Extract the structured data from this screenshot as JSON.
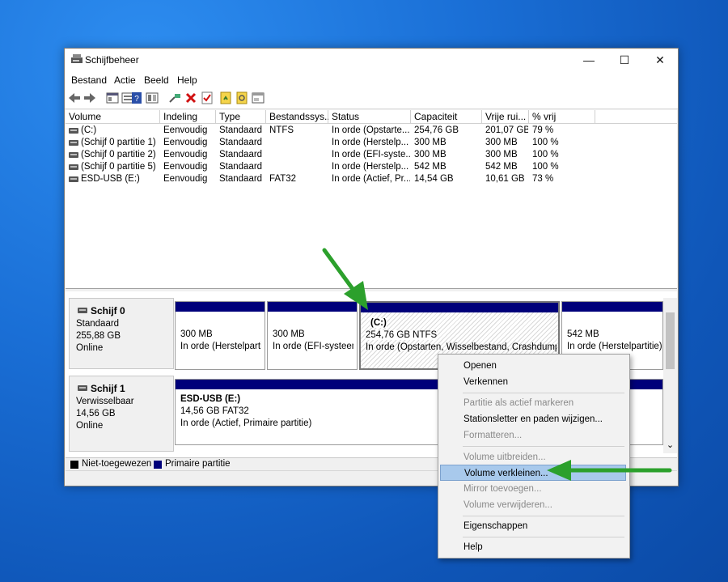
{
  "window": {
    "title": "Schijfbeheer",
    "controls": {
      "minimize": "—",
      "maximize": "☐",
      "close": "✕"
    }
  },
  "menu": [
    "Bestand",
    "Actie",
    "Beeld",
    "Help"
  ],
  "toolbar_icons": [
    "back-arrow-icon",
    "forward-arrow-icon",
    "properties-icon",
    "console-icon",
    "help-icon",
    "view-icon",
    "connect-icon",
    "delete-icon",
    "check-icon",
    "doc-icon",
    "search-doc-icon",
    "window-icon"
  ],
  "table": {
    "headers": [
      "Volume",
      "Indeling",
      "Type",
      "Bestandssys...",
      "Status",
      "Capaciteit",
      "Vrije rui...",
      "% vrij"
    ],
    "rows": [
      [
        "(C:)",
        "Eenvoudig",
        "Standaard",
        "NTFS",
        "In orde (Opstarte...",
        "254,76 GB",
        "201,07 GB",
        "79 %"
      ],
      [
        "(Schijf 0 partitie 1)",
        "Eenvoudig",
        "Standaard",
        "",
        "In orde (Herstelp...",
        "300 MB",
        "300 MB",
        "100 %"
      ],
      [
        "(Schijf 0 partitie 2)",
        "Eenvoudig",
        "Standaard",
        "",
        "In orde (EFI-syste...",
        "300 MB",
        "300 MB",
        "100 %"
      ],
      [
        "(Schijf 0 partitie 5)",
        "Eenvoudig",
        "Standaard",
        "",
        "In orde (Herstelp...",
        "542 MB",
        "542 MB",
        "100 %"
      ],
      [
        "ESD-USB (E:)",
        "Eenvoudig",
        "Standaard",
        "FAT32",
        "In orde (Actief, Pr...",
        "14,54 GB",
        "10,61 GB",
        "73 %"
      ]
    ]
  },
  "disks": [
    {
      "name": "Schijf 0",
      "kind": "Standaard",
      "size": "255,88 GB",
      "state": "Online",
      "partitions": [
        {
          "title": "",
          "line1": "300 MB",
          "line2": "In orde (Herstelpartit"
        },
        {
          "title": "",
          "line1": "300 MB",
          "line2": "In orde (EFI-systeemp"
        },
        {
          "title": "(C:)",
          "line1": "254,76 GB NTFS",
          "line2": "In orde (Opstarten, Wisselbestand, Crashdump, S"
        },
        {
          "title": "",
          "line1": "542 MB",
          "line2": "In orde (Herstelpartitie)"
        }
      ]
    },
    {
      "name": "Schijf 1",
      "kind": "Verwisselbaar",
      "size": "14,56 GB",
      "state": "Online",
      "partitions": [
        {
          "title": "ESD-USB  (E:)",
          "line1": "14,56 GB FAT32",
          "line2": "In orde (Actief, Primaire partitie)"
        }
      ]
    }
  ],
  "legend": {
    "unallocated": "Niet-toegewezen",
    "primary": "Primaire partitie",
    "unallocated_color": "#000000",
    "primary_color": "#00007a"
  },
  "context_menu": [
    {
      "label": "Openen",
      "enabled": true
    },
    {
      "label": "Verkennen",
      "enabled": true
    },
    {
      "label": "Partitie als actief markeren",
      "enabled": false
    },
    {
      "label": "Stationsletter en paden wijzigen...",
      "enabled": true
    },
    {
      "label": "Formatteren...",
      "enabled": false
    },
    {
      "label": "Volume uitbreiden...",
      "enabled": false
    },
    {
      "label": "Volume verkleinen...",
      "enabled": true,
      "highlighted": true
    },
    {
      "label": "Mirror toevoegen...",
      "enabled": false
    },
    {
      "label": "Volume verwijderen...",
      "enabled": false
    },
    {
      "label": "Eigenschappen",
      "enabled": true
    },
    {
      "label": "Help",
      "enabled": true
    }
  ],
  "annotation_color": "#2ca02c",
  "scroll_down_glyph": "⌄"
}
